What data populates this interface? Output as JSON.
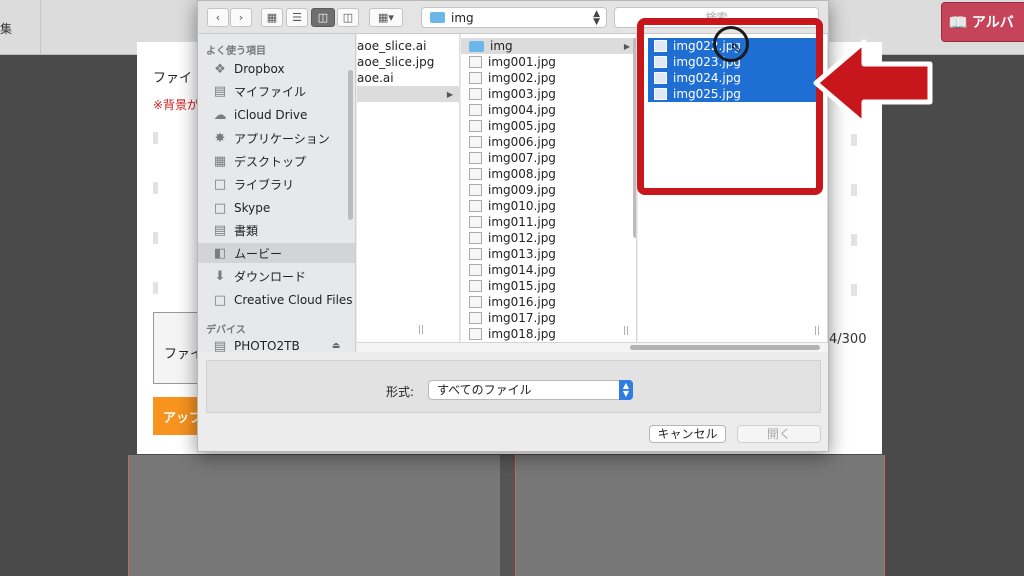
{
  "background": {
    "corner_text": "集",
    "album_button": "アルバ",
    "modal_title": "ファイ",
    "modal_warning": "※背景が",
    "file_slot": "ファイ",
    "upload_button": "アップ",
    "counter": "4/300"
  },
  "dialog": {
    "path": "img",
    "search_placeholder": "検索",
    "sidebar": {
      "favorites_header": "よく使う項目",
      "items": [
        {
          "label": "Dropbox",
          "icon": "dropbox-icon"
        },
        {
          "label": "マイファイル",
          "icon": "drive-icon"
        },
        {
          "label": "iCloud Drive",
          "icon": "cloud-icon"
        },
        {
          "label": "アプリケーション",
          "icon": "applications-icon"
        },
        {
          "label": "デスクトップ",
          "icon": "desktop-icon"
        },
        {
          "label": "ライブラリ",
          "icon": "folder-icon"
        },
        {
          "label": "Skype",
          "icon": "folder-icon"
        },
        {
          "label": "書類",
          "icon": "documents-icon"
        },
        {
          "label": "ムービー",
          "icon": "movies-icon"
        },
        {
          "label": "ダウンロード",
          "icon": "download-icon"
        },
        {
          "label": "Creative Cloud Files",
          "icon": "folder-icon"
        }
      ],
      "devices_header": "デバイス",
      "device": "PHOTO2TB"
    },
    "column1": [
      "aoe_slice.ai",
      "aoe_slice.jpg",
      "aoe.ai"
    ],
    "column2_folder": "img",
    "column2_files": [
      "img001.jpg",
      "img002.jpg",
      "img003.jpg",
      "img004.jpg",
      "img005.jpg",
      "img006.jpg",
      "img007.jpg",
      "img008.jpg",
      "img009.jpg",
      "img010.jpg",
      "img011.jpg",
      "img012.jpg",
      "img013.jpg",
      "img014.jpg",
      "img015.jpg",
      "img016.jpg",
      "img017.jpg",
      "img018.jpg"
    ],
    "column3_files": [
      "img022.jpg",
      "img023.jpg",
      "img024.jpg",
      "img025.jpg"
    ],
    "format_label": "形式:",
    "format_value": "すべてのファイル",
    "cancel_label": "キャンセル",
    "open_label": "開く"
  },
  "annotation": {
    "highlight_color": "#c8161d",
    "selection_color": "#1f6ed4"
  }
}
